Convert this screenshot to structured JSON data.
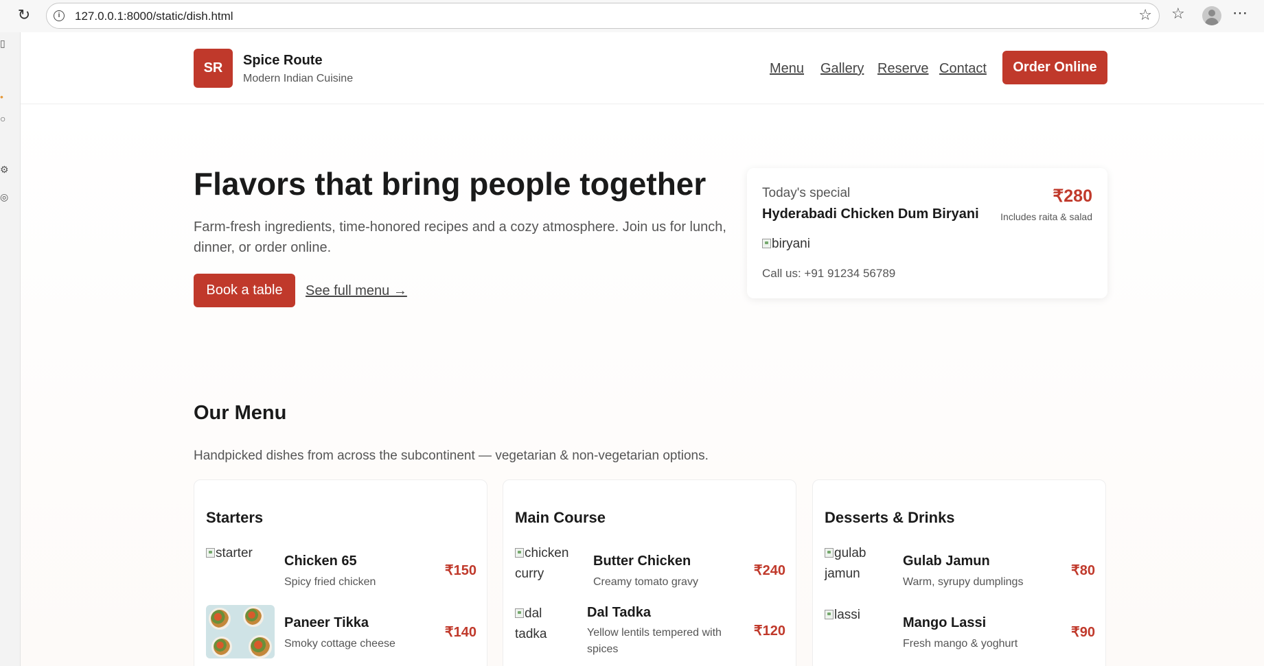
{
  "browser": {
    "url": "127.0.0.1:8000/static/dish.html"
  },
  "header": {
    "logo_initials": "SR",
    "brand_name": "Spice Route",
    "brand_tagline": "Modern Indian Cuisine",
    "nav": [
      "Menu",
      "Gallery",
      "Reserve",
      "Contact"
    ],
    "order_label": "Order Online"
  },
  "hero": {
    "title": "Flavors that bring people together",
    "subtitle": "Farm-fresh ingredients, time-honored recipes and a cozy atmosphere. Join us for lunch, dinner, or order online.",
    "book_label": "Book a table",
    "see_menu_label": "See full menu →"
  },
  "special": {
    "label": "Today's special",
    "name": "Hyderabadi Chicken Dum Biryani",
    "price": "₹280",
    "note": "Includes raita & salad",
    "image_alt": "biryani",
    "call": "Call us: +91 91234 56789"
  },
  "menu": {
    "title": "Our Menu",
    "subtitle": "Handpicked dishes from across the subcontinent — vegetarian & non-vegetarian options.",
    "categories": [
      {
        "title": "Starters",
        "items": [
          {
            "image_alt": "starter",
            "name": "Chicken 65",
            "desc": "Spicy fried chicken",
            "price": "₹150"
          },
          {
            "image_alt": "",
            "name": "Paneer Tikka",
            "desc": "Smoky cottage cheese",
            "price": "₹140"
          }
        ]
      },
      {
        "title": "Main Course",
        "items": [
          {
            "image_alt": "chicken curry",
            "name": "Butter Chicken",
            "desc": "Creamy tomato gravy",
            "price": "₹240"
          },
          {
            "image_alt": "dal tadka",
            "name": "Dal Tadka",
            "desc": "Yellow lentils tempered with spices",
            "price": "₹120"
          }
        ]
      },
      {
        "title": "Desserts & Drinks",
        "items": [
          {
            "image_alt": "gulab jamun",
            "name": "Gulab Jamun",
            "desc": "Warm, syrupy dumplings",
            "price": "₹80"
          },
          {
            "image_alt": "lassi",
            "name": "Mango Lassi",
            "desc": "Fresh mango & yoghurt",
            "price": "₹90"
          }
        ]
      }
    ]
  },
  "colors": {
    "accent": "#c0392b",
    "text": "#1a1a1a",
    "muted": "#555555"
  }
}
